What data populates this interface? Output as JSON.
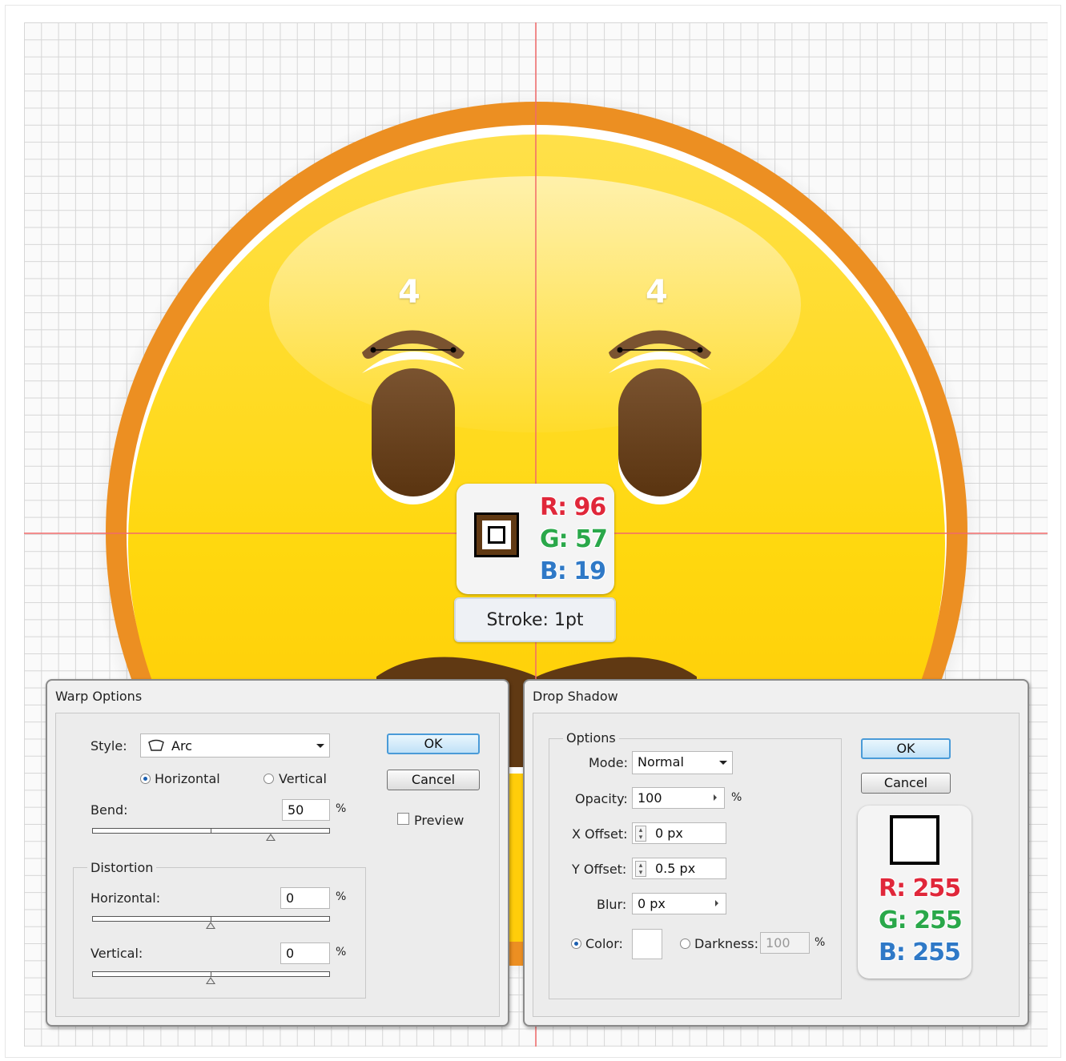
{
  "canvas": {
    "guide_color": "#f26a6a",
    "face": {
      "rim_color": "#ec8f22",
      "fill_top": "#ffd400",
      "fill_bottom": "#ffbf00",
      "feature_color": "#603913"
    },
    "guide_numbers": [
      "4",
      "4"
    ]
  },
  "stroke_callout": {
    "r_label": "R: 96",
    "g_label": "G: 57",
    "b_label": "B: 19",
    "stroke_label": "Stroke: 1pt",
    "swatch_color": "#603913"
  },
  "warp_options": {
    "title": "Warp Options",
    "style_label": "Style:",
    "style_value": "Arc",
    "style_icon": "arc-warp-icon",
    "orientation_horizontal": "Horizontal",
    "orientation_vertical": "Vertical",
    "bend_label": "Bend:",
    "bend_value": "50",
    "bend_unit": "%",
    "bend_fraction": 0.75,
    "distortion_label": "Distortion",
    "horizontal_label": "Horizontal:",
    "horizontal_value": "0",
    "horizontal_unit": "%",
    "vertical_label": "Vertical:",
    "vertical_value": "0",
    "vertical_unit": "%",
    "ok": "OK",
    "cancel": "Cancel",
    "preview": "Preview"
  },
  "drop_shadow": {
    "title": "Drop Shadow",
    "options_label": "Options",
    "mode_label": "Mode:",
    "mode_value": "Normal",
    "opacity_label": "Opacity:",
    "opacity_value": "100",
    "opacity_unit": "%",
    "x_offset_label": "X Offset:",
    "x_offset_value": "0 px",
    "y_offset_label": "Y Offset:",
    "y_offset_value": "0.5 px",
    "blur_label": "Blur:",
    "blur_value": "0 px",
    "color_label": "Color:",
    "darkness_label": "Darkness:",
    "darkness_value": "100",
    "darkness_unit": "%",
    "ok": "OK",
    "cancel": "Cancel",
    "r_label": "R: 255",
    "g_label": "G: 255",
    "b_label": "B: 255",
    "swatch_color": "#ffffff"
  }
}
